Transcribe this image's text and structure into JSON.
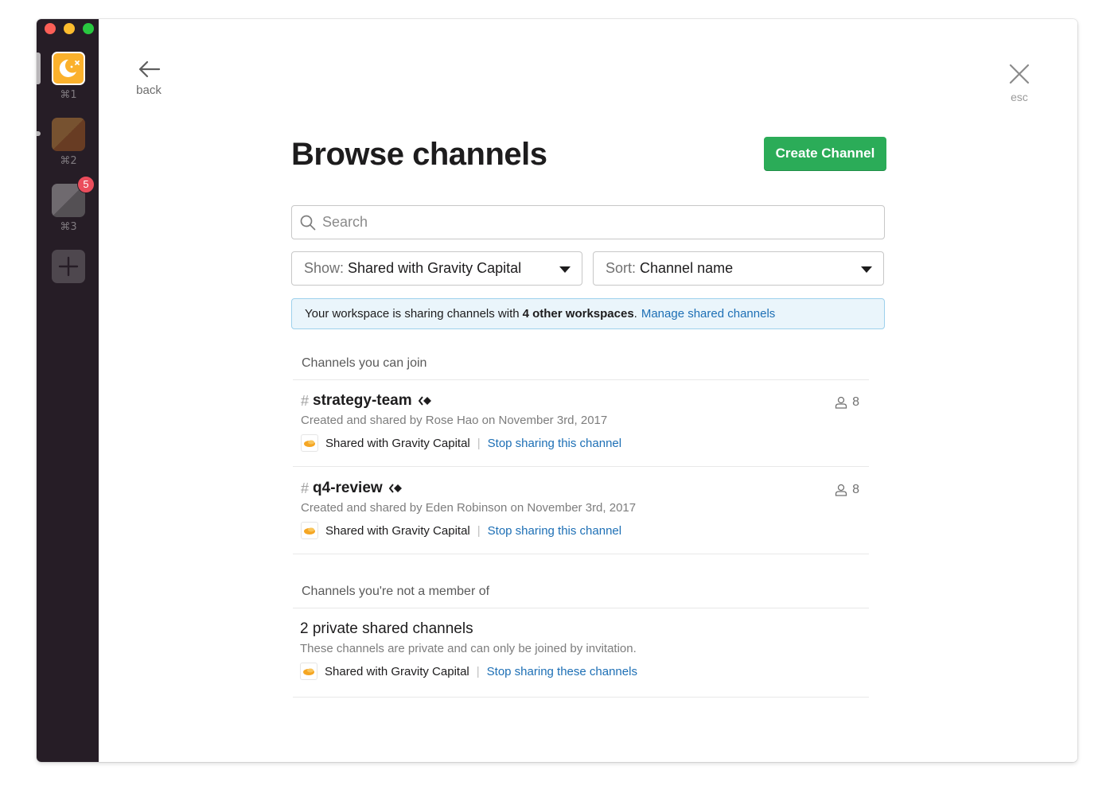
{
  "window": {
    "traffic_lights": [
      "close",
      "minimize",
      "zoom"
    ]
  },
  "sidebar": {
    "workspaces": [
      {
        "shortcut": "⌘1",
        "icon": "moon-stars-icon",
        "color": "#fbb12c",
        "active": true
      },
      {
        "shortcut": "⌘2",
        "icon": "workspace-tile-icon",
        "color": "#7b5530",
        "active": false
      },
      {
        "shortcut": "⌘3",
        "icon": "workspace-tile-icon",
        "color": "#6f6a6f",
        "active": false,
        "badge": "5"
      }
    ],
    "add_icon": "plus-icon"
  },
  "nav": {
    "back_label": "back",
    "esc_label": "esc"
  },
  "header": {
    "title": "Browse channels",
    "create_button": "Create Channel"
  },
  "search": {
    "placeholder": "Search",
    "value": ""
  },
  "filters": {
    "show_prefix": "Show:",
    "show_value": "Shared with Gravity Capital",
    "sort_prefix": "Sort:",
    "sort_value": "Channel name"
  },
  "banner": {
    "text_before": "Your workspace is sharing channels with",
    "bold": "4 other workspaces",
    "text_after": ".",
    "link": "Manage shared channels"
  },
  "sections": {
    "joinable": {
      "heading": "Channels you can join",
      "channels": [
        {
          "hash": "#",
          "name": "strategy-team",
          "members": "8",
          "meta": "Created and shared by Rose Hao on November 3rd, 2017",
          "shared_with": "Shared with Gravity Capital",
          "action": "Stop sharing this channel"
        },
        {
          "hash": "#",
          "name": "q4-review",
          "members": "8",
          "meta": "Created and shared by Eden Robinson on November 3rd, 2017",
          "shared_with": "Shared with Gravity Capital",
          "action": "Stop sharing this channel"
        }
      ]
    },
    "not_member": {
      "heading": "Channels you're not a member of",
      "private": {
        "title": "2 private shared channels",
        "meta": "These channels are private and can only be joined by invitation.",
        "shared_with": "Shared with Gravity Capital",
        "action": "Stop sharing these channels"
      }
    }
  },
  "colors": {
    "primary_button": "#2bac58",
    "link": "#1d6fb5",
    "sidebar_bg": "#261d26",
    "badge": "#eb4d5c",
    "banner_bg": "#eaf5fb"
  }
}
